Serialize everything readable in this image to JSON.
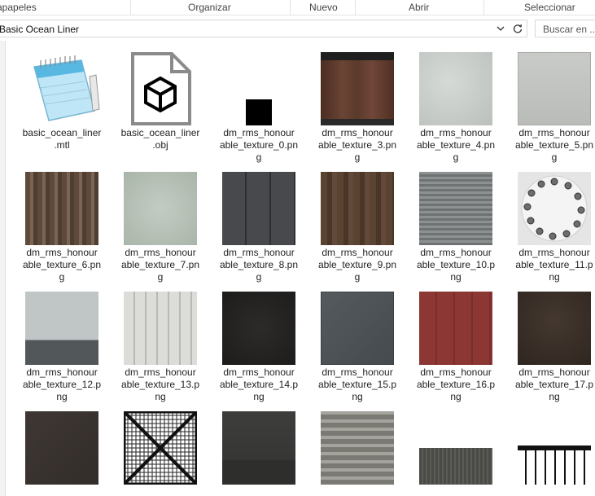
{
  "ribbon": {
    "labels": [
      "apapeles",
      "Organizar",
      "Nuevo",
      "Abrir",
      "Seleccionar"
    ]
  },
  "address": {
    "path": "Basic Ocean Liner",
    "search_placeholder": "Buscar en ..."
  },
  "files": [
    {
      "line1": "basic_ocean_liner",
      "line2": ".mtl",
      "line3": "",
      "icon": "notepad-icon"
    },
    {
      "line1": "basic_ocean_liner",
      "line2": ".obj",
      "line3": "",
      "icon": "3d-object-file-icon"
    },
    {
      "line1": "dm_rms_honour",
      "line2": "able_texture_0.pn",
      "line3": "g",
      "color": "#000000"
    },
    {
      "line1": "dm_rms_honour",
      "line2": "able_texture_3.pn",
      "line3": "g",
      "color": "#5e3b2c"
    },
    {
      "line1": "dm_rms_honour",
      "line2": "able_texture_4.pn",
      "line3": "g",
      "color": "#c9cdc9"
    },
    {
      "line1": "dm_rms_honour",
      "line2": "able_texture_5.pn",
      "line3": "g",
      "color": "#c2c5c1"
    },
    {
      "line1": "dm_rms_honour",
      "line2": "able_texture_6.pn",
      "line3": "g",
      "color": "#6b5546"
    },
    {
      "line1": "dm_rms_honour",
      "line2": "able_texture_7.pn",
      "line3": "g",
      "color": "#b8c2b8"
    },
    {
      "line1": "dm_rms_honour",
      "line2": "able_texture_8.pn",
      "line3": "g",
      "color": "#4f5356"
    },
    {
      "line1": "dm_rms_honour",
      "line2": "able_texture_9.pn",
      "line3": "g",
      "color": "#55402f"
    },
    {
      "line1": "dm_rms_honour",
      "line2": "able_texture_10.p",
      "line3": "ng",
      "color": "#7b7f80"
    },
    {
      "line1": "dm_rms_honour",
      "line2": "able_texture_11.p",
      "line3": "ng",
      "color": "#e6e7e6"
    },
    {
      "line1": "dm_rms_honour",
      "line2": "able_texture_12.p",
      "line3": "ng",
      "color": "#bcc3c2"
    },
    {
      "line1": "dm_rms_honour",
      "line2": "able_texture_13.p",
      "line3": "ng",
      "color": "#d6d6d2"
    },
    {
      "line1": "dm_rms_honour",
      "line2": "able_texture_14.p",
      "line3": "ng",
      "color": "#262524"
    },
    {
      "line1": "dm_rms_honour",
      "line2": "able_texture_15.p",
      "line3": "ng",
      "color": "#4e5458"
    },
    {
      "line1": "dm_rms_honour",
      "line2": "able_texture_16.p",
      "line3": "ng",
      "color": "#8a3633"
    },
    {
      "line1": "dm_rms_honour",
      "line2": "able_texture_17.p",
      "line3": "ng",
      "color": "#3a2f27"
    },
    {
      "line1": "",
      "line2": "",
      "line3": "",
      "color": "#3b3532"
    },
    {
      "line1": "",
      "line2": "",
      "line3": "",
      "color": "#ffffff"
    },
    {
      "line1": "",
      "line2": "",
      "line3": "",
      "color": "#3a3a38"
    },
    {
      "line1": "",
      "line2": "",
      "line3": "",
      "color": "#8b8a83"
    },
    {
      "line1": "",
      "line2": "",
      "line3": "",
      "color": "#4c4c48"
    },
    {
      "line1": "",
      "line2": "",
      "line3": "",
      "color": "#ffffff"
    }
  ]
}
